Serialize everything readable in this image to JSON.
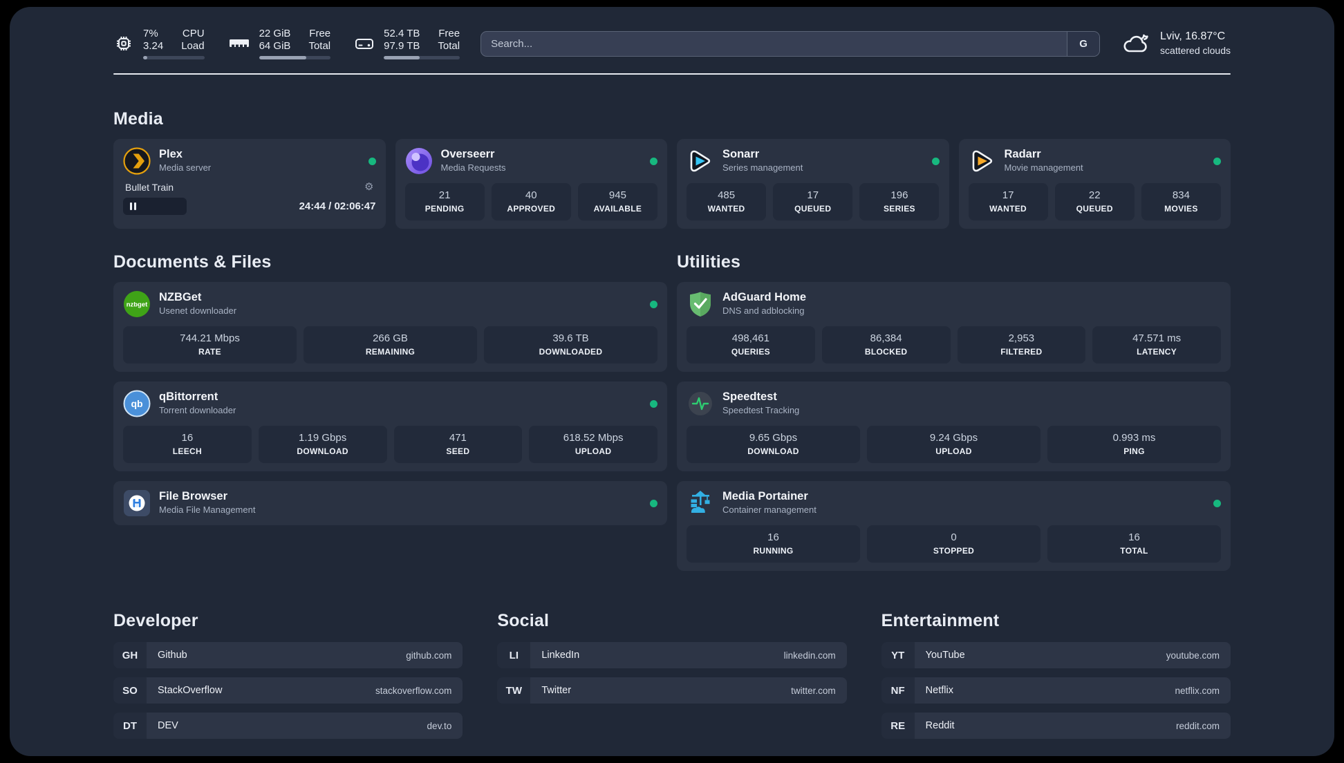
{
  "colors": {
    "page_bg": "#000000",
    "panel_bg": "#202837",
    "card_bg": "#2a3242",
    "statbox_bg": "#222a3a",
    "status_online": "#17b87f",
    "plex_accent": "#e5a00d",
    "sonarr_accent": "#35c5f4",
    "radarr_accent": "#f7a928"
  },
  "header": {
    "stats": [
      {
        "icon": "cpu-icon",
        "values": [
          "7%",
          "3.24"
        ],
        "labels": [
          "CPU",
          "Load"
        ],
        "progress": 7
      },
      {
        "icon": "ram-icon",
        "values": [
          "22 GiB",
          "64 GiB"
        ],
        "labels": [
          "Free",
          "Total"
        ],
        "progress": 66
      },
      {
        "icon": "disk-icon",
        "values": [
          "52.4 TB",
          "97.9 TB"
        ],
        "labels": [
          "Free",
          "Total"
        ],
        "progress": 47
      }
    ],
    "search": {
      "placeholder": "Search...",
      "engine_label": "G"
    },
    "weather": {
      "location": "Lviv, 16.87°C",
      "condition": "scattered clouds"
    }
  },
  "media": {
    "title": "Media",
    "plex": {
      "name": "Plex",
      "desc": "Media server",
      "now_playing": "Bullet Train",
      "pause_icon": "pause-icon",
      "time": "24:44 / 02:06:47"
    },
    "overseerr": {
      "name": "Overseerr",
      "desc": "Media Requests",
      "stats": [
        {
          "value": "21",
          "label": "PENDING"
        },
        {
          "value": "40",
          "label": "APPROVED"
        },
        {
          "value": "945",
          "label": "AVAILABLE"
        }
      ]
    },
    "sonarr": {
      "name": "Sonarr",
      "desc": "Series management",
      "stats": [
        {
          "value": "485",
          "label": "WANTED"
        },
        {
          "value": "17",
          "label": "QUEUED"
        },
        {
          "value": "196",
          "label": "SERIES"
        }
      ]
    },
    "radarr": {
      "name": "Radarr",
      "desc": "Movie management",
      "stats": [
        {
          "value": "17",
          "label": "WANTED"
        },
        {
          "value": "22",
          "label": "QUEUED"
        },
        {
          "value": "834",
          "label": "MOVIES"
        }
      ]
    }
  },
  "documents": {
    "title": "Documents & Files",
    "nzbget": {
      "name": "NZBGet",
      "desc": "Usenet downloader",
      "stats": [
        {
          "value": "744.21 Mbps",
          "label": "RATE"
        },
        {
          "value": "266 GB",
          "label": "REMAINING"
        },
        {
          "value": "39.6 TB",
          "label": "DOWNLOADED"
        }
      ]
    },
    "qbittorrent": {
      "name": "qBittorrent",
      "desc": "Torrent downloader",
      "stats": [
        {
          "value": "16",
          "label": "LEECH"
        },
        {
          "value": "1.19 Gbps",
          "label": "DOWNLOAD"
        },
        {
          "value": "471",
          "label": "SEED"
        },
        {
          "value": "618.52 Mbps",
          "label": "UPLOAD"
        }
      ]
    },
    "filebrowser": {
      "name": "File Browser",
      "desc": "Media File Management"
    }
  },
  "utilities": {
    "title": "Utilities",
    "adguard": {
      "name": "AdGuard Home",
      "desc": "DNS and adblocking",
      "stats": [
        {
          "value": "498,461",
          "label": "QUERIES"
        },
        {
          "value": "86,384",
          "label": "BLOCKED"
        },
        {
          "value": "2,953",
          "label": "FILTERED"
        },
        {
          "value": "47.571 ms",
          "label": "LATENCY"
        }
      ]
    },
    "speedtest": {
      "name": "Speedtest",
      "desc": "Speedtest Tracking",
      "stats": [
        {
          "value": "9.65 Gbps",
          "label": "DOWNLOAD"
        },
        {
          "value": "9.24 Gbps",
          "label": "UPLOAD"
        },
        {
          "value": "0.993 ms",
          "label": "PING"
        }
      ]
    },
    "portainer": {
      "name": "Media Portainer",
      "desc": "Container management",
      "stats": [
        {
          "value": "16",
          "label": "RUNNING"
        },
        {
          "value": "0",
          "label": "STOPPED"
        },
        {
          "value": "16",
          "label": "TOTAL"
        }
      ]
    }
  },
  "bookmarks": [
    {
      "title": "Developer",
      "links": [
        {
          "abbr": "GH",
          "name": "Github",
          "url": "github.com"
        },
        {
          "abbr": "SO",
          "name": "StackOverflow",
          "url": "stackoverflow.com"
        },
        {
          "abbr": "DT",
          "name": "DEV",
          "url": "dev.to"
        }
      ]
    },
    {
      "title": "Social",
      "links": [
        {
          "abbr": "LI",
          "name": "LinkedIn",
          "url": "linkedin.com"
        },
        {
          "abbr": "TW",
          "name": "Twitter",
          "url": "twitter.com"
        }
      ]
    },
    {
      "title": "Entertainment",
      "links": [
        {
          "abbr": "YT",
          "name": "YouTube",
          "url": "youtube.com"
        },
        {
          "abbr": "NF",
          "name": "Netflix",
          "url": "netflix.com"
        },
        {
          "abbr": "RE",
          "name": "Reddit",
          "url": "reddit.com"
        }
      ]
    }
  ]
}
